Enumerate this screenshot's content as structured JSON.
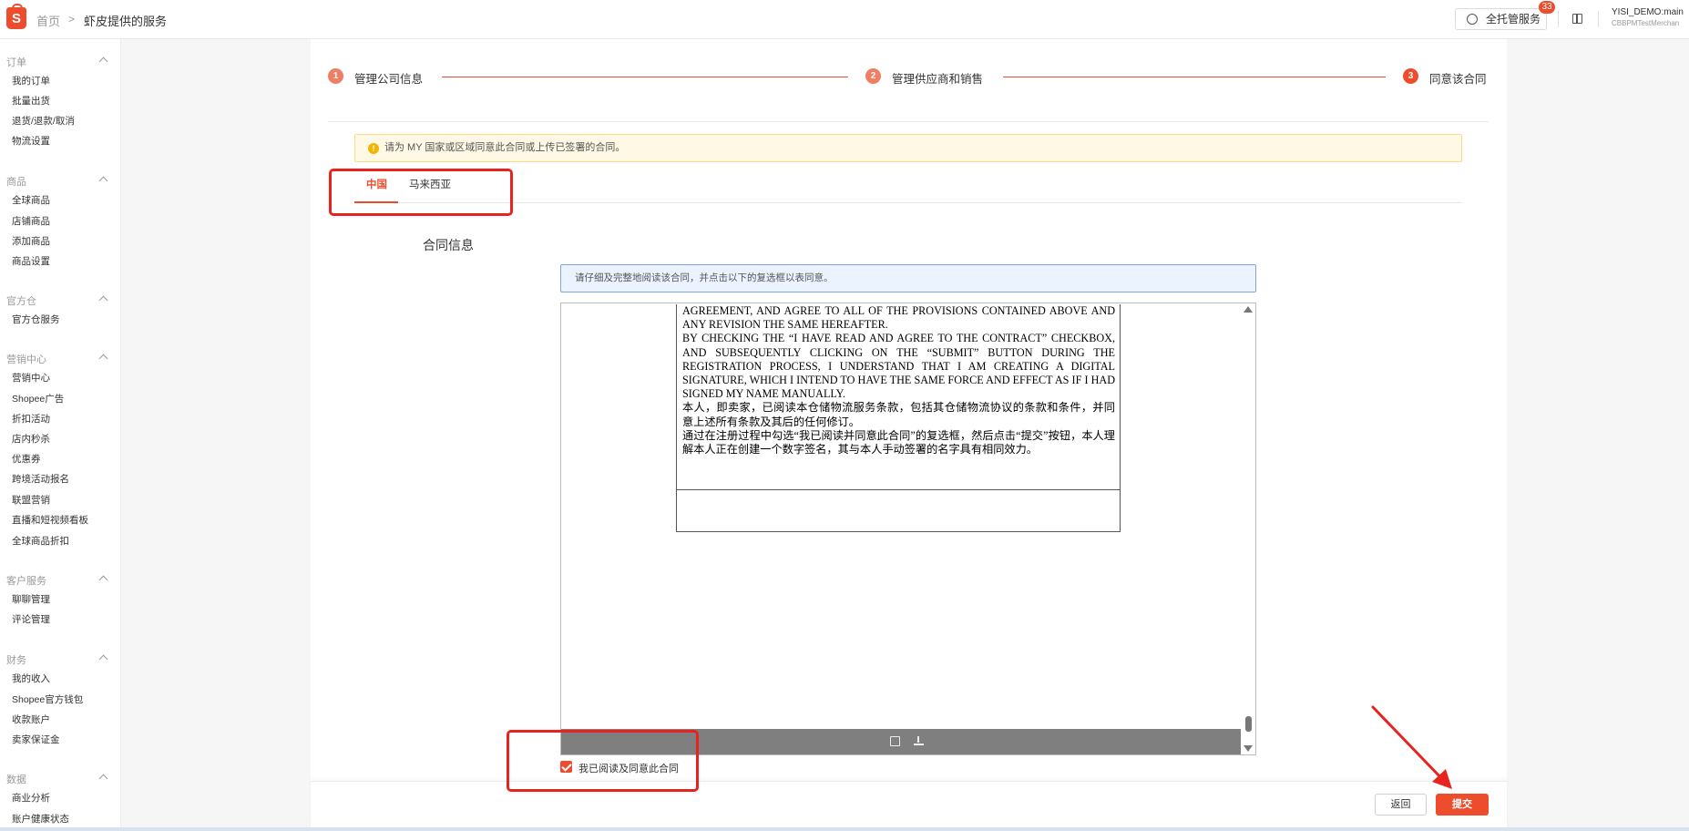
{
  "topbar": {
    "breadcrumb_home": "首页",
    "breadcrumb_separator": ">",
    "breadcrumb_current": "虾皮提供的服务",
    "managed_service_label": "全托管服务",
    "notification_count": "33",
    "user_name": "YISI_DEMO:main",
    "user_sub": "CBBPMTestMerchan",
    "logo_letter": "S"
  },
  "sidebar": {
    "sections": [
      {
        "title": "订单",
        "items": [
          "我的订单",
          "批量出货",
          "退货/退款/取消",
          "物流设置"
        ]
      },
      {
        "title": "商品",
        "items": [
          "全球商品",
          "店铺商品",
          "添加商品",
          "商品设置"
        ]
      },
      {
        "title": "官方仓",
        "items": [
          "官方仓服务"
        ]
      },
      {
        "title": "营销中心",
        "items": [
          "营销中心",
          "Shopee广告",
          "折扣活动",
          "店内秒杀",
          "优惠券",
          "跨境活动报名",
          "联盟营销",
          "直播和短视频看板",
          "全球商品折扣"
        ]
      },
      {
        "title": "客户服务",
        "items": [
          "聊聊管理",
          "评论管理"
        ]
      },
      {
        "title": "财务",
        "items": [
          "我的收入",
          "Shopee官方钱包",
          "收款账户",
          "卖家保证金"
        ]
      },
      {
        "title": "数据",
        "items": [
          "商业分析",
          "账户健康状态"
        ]
      }
    ]
  },
  "steps": [
    {
      "num": "1",
      "label": "管理公司信息"
    },
    {
      "num": "2",
      "label": "管理供应商和销售"
    },
    {
      "num": "3",
      "label": "同意该合同"
    }
  ],
  "notice": {
    "icon": "!",
    "text": "请为 MY 国家或区域同意此合同或上传已签署的合同。"
  },
  "tabs": [
    "中国",
    "马来西亚"
  ],
  "contract": {
    "section_title": "合同信息",
    "info_text": "请仔细及完整地阅读该合同，并点击以下的复选框以表同意。",
    "doc_paragraphs": [
      "AGREEMENT, AND AGREE TO ALL OF THE PROVISIONS CONTAINED ABOVE AND ANY REVISION THE SAME HEREAFTER.",
      "BY CHECKING THE “I HAVE READ AND AGREE TO THE CONTRACT” CHECKBOX, AND SUBSEQUENTLY CLICKING ON THE “SUBMIT” BUTTON DURING THE REGISTRATION PROCESS, I UNDERSTAND THAT I AM CREATING A DIGITAL SIGNATURE, WHICH I INTEND TO HAVE THE SAME FORCE AND EFFECT AS IF I HAD SIGNED MY NAME MANUALLY.",
      "本人，即卖家，已阅读本仓储物流服务条款，包括其仓储物流协议的条款和条件，并同意上述所有条款及其后的任何修订。",
      "通过在注册过程中勾选“我已阅读并同意此合同”的复选框，然后点击“提交”按钮，本人理解本人正在创建一个数字签名，其与本人手动签署的名字具有相同效力。"
    ],
    "agree_label": "我已阅读及同意此合同",
    "agree_checked": true
  },
  "actions": {
    "back_label": "返回",
    "submit_label": "提交"
  },
  "colors": {
    "brand": "#ee4d2d",
    "annotation": "#e8231f",
    "notice_bg": "#fff8e4",
    "info_bg": "#eaf3ff"
  }
}
